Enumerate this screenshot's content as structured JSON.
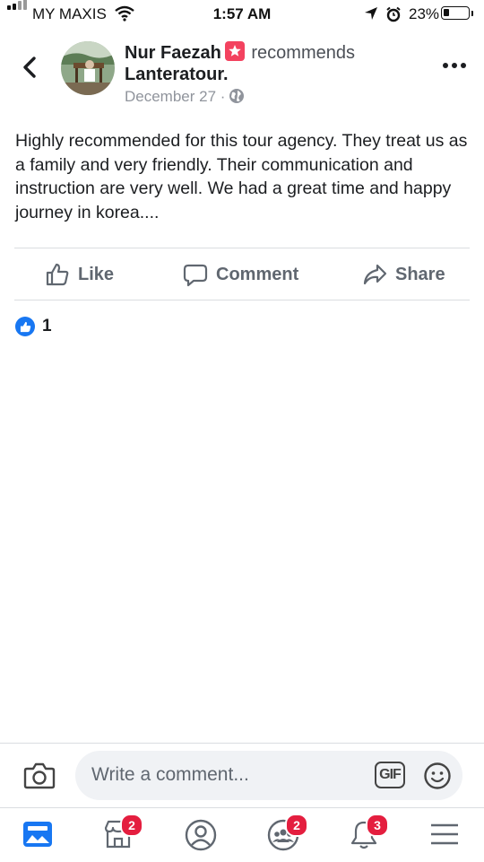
{
  "status_bar": {
    "carrier": "MY MAXIS",
    "time": "1:57 AM",
    "battery": "23%"
  },
  "post": {
    "author": "Nur Faezah",
    "action": "recommends",
    "page": "Lanteratour.",
    "date": "December 27 ·",
    "text": "Highly recommended for this tour agency. They treat us as a family and very friendly. Their communication and instruction are very well. We had a great time and happy journey in korea...."
  },
  "actions": {
    "like": "Like",
    "comment": "Comment",
    "share": "Share"
  },
  "reactions": {
    "count": "1"
  },
  "comment_bar": {
    "placeholder": "Write a comment...",
    "gif": "GIF"
  },
  "tab_bar": {
    "marketplace_badge": "2",
    "groups_badge": "2",
    "notifications_badge": "3"
  },
  "colors": {
    "accent": "#1877f2",
    "badge": "#e41e3f",
    "recommend_badge": "#f3425f"
  }
}
